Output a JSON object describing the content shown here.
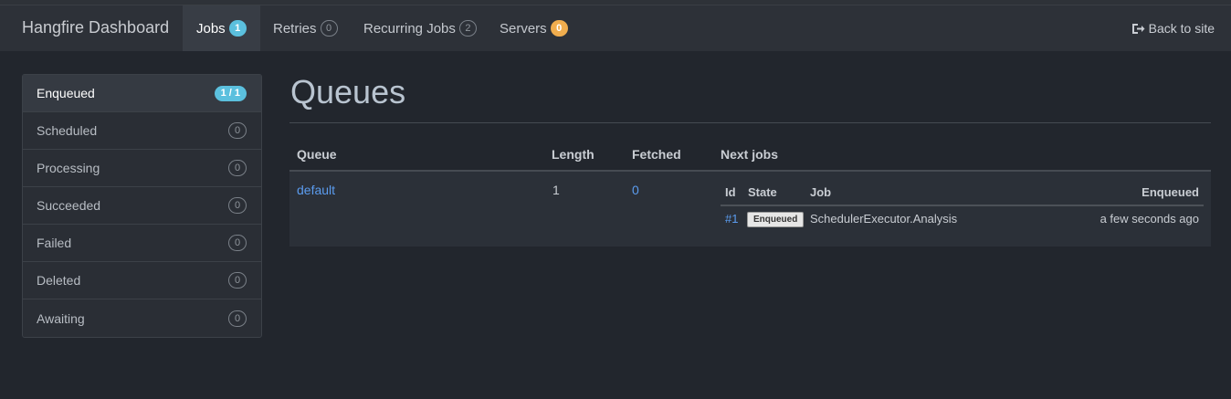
{
  "navbar": {
    "brand": "Hangfire Dashboard",
    "items": [
      {
        "label": "Jobs",
        "badge": "1"
      },
      {
        "label": "Retries",
        "badge": "0"
      },
      {
        "label": "Recurring Jobs",
        "badge": "2"
      },
      {
        "label": "Servers",
        "badge": "0"
      }
    ],
    "back_label": "Back to site"
  },
  "sidebar": {
    "items": [
      {
        "label": "Enqueued",
        "count": "1 / 1"
      },
      {
        "label": "Scheduled",
        "count": "0"
      },
      {
        "label": "Processing",
        "count": "0"
      },
      {
        "label": "Succeeded",
        "count": "0"
      },
      {
        "label": "Failed",
        "count": "0"
      },
      {
        "label": "Deleted",
        "count": "0"
      },
      {
        "label": "Awaiting",
        "count": "0"
      }
    ]
  },
  "main": {
    "title": "Queues",
    "table": {
      "headers": {
        "queue": "Queue",
        "length": "Length",
        "fetched": "Fetched",
        "next": "Next jobs"
      },
      "rows": [
        {
          "queue": "default",
          "length": "1",
          "fetched": "0",
          "next_jobs": {
            "headers": {
              "id": "Id",
              "state": "State",
              "job": "Job",
              "enqueued": "Enqueued"
            },
            "rows": [
              {
                "id": "#1",
                "state": "Enqueued",
                "job": "SchedulerExecutor.Analysis",
                "enqueued": "a few seconds ago"
              }
            ]
          }
        }
      ]
    }
  }
}
